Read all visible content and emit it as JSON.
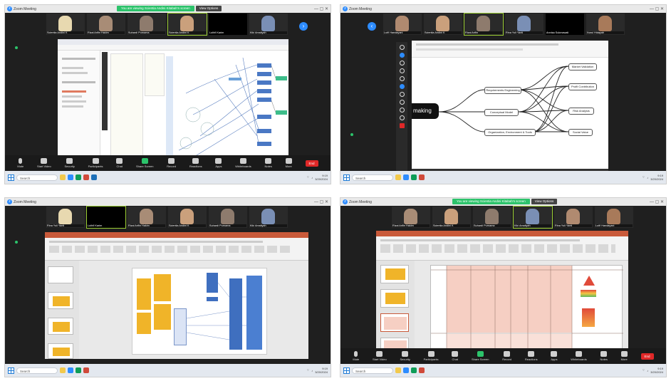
{
  "app_title": "Zoom Meeting",
  "share_banner": {
    "status": "You are viewing Scientia Andini Kitabah's screen",
    "button": "View Options"
  },
  "toolbar": {
    "mute": "Mute",
    "start_video": "Start Video",
    "security": "Security",
    "participants": "Participants",
    "chat": "Chat",
    "share_screen": "Share Screen",
    "record": "Record",
    "reactions": "Reactions",
    "apps": "Apps",
    "whiteboards": "Whiteboards",
    "notes": "Notes",
    "more": "More",
    "end": "End"
  },
  "taskbar": {
    "search_placeholder": "Search",
    "time": "9:19",
    "date": "3/20/2024"
  },
  "panels": [
    {
      "participants": [
        "Scientia Andini K",
        "Rizal Arifin Hakim",
        "Suhardi Purnama",
        "Scientia Andini K",
        "Luthfi Karim",
        "Kiki Amaliyah"
      ]
    },
    {
      "participants": [
        "Lutfi Handayani",
        "Scientia Andini K",
        "Rizal Arifin",
        "Rina Yuli Yanti",
        "Annisa Sukmawati",
        "Nurul Hidayah"
      ]
    },
    {
      "participants": [
        "Rina Yuli Yanti",
        "Luthfi Karim",
        "Rizal Arifin Hakim",
        "Scientia Andini K",
        "Suhardi Purnama",
        "Kiki Amaliyah"
      ]
    },
    {
      "participants": [
        "Rizal Arifin Hakim",
        "Scientia Andini K",
        "Suhardi Purnama",
        "Kiki Amaliyah",
        "Rina Yuli Yanti",
        "Lutfi Handayani"
      ]
    }
  ],
  "mindmap": {
    "central": "making",
    "mid_nodes": [
      "Requirements Engineering",
      "Conceptual Model",
      "Organization, Environment & Tools"
    ],
    "right_nodes": [
      "Market Validation",
      "Profit Contribution",
      "Risk Analysis",
      "Social Value"
    ]
  },
  "colors": {
    "zoom_blue": "#2d8cff",
    "share_green": "#2cc36b",
    "end_red": "#e02828",
    "ppt_orange": "#c95a3a",
    "sticky_yellow": "#f0b429"
  }
}
